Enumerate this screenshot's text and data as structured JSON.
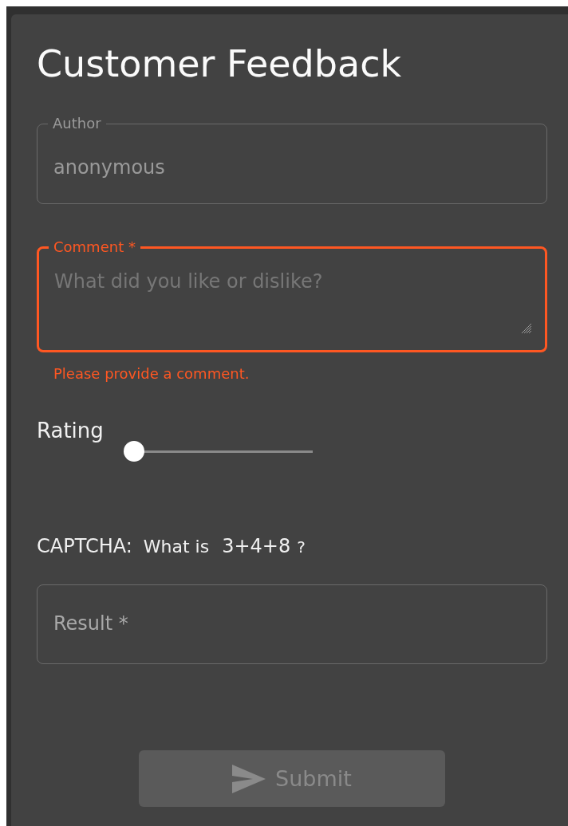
{
  "title": "Customer Feedback",
  "author": {
    "label": "Author",
    "value": "anonymous",
    "disabled": true
  },
  "comment": {
    "label": "Comment *",
    "placeholder": "What did you like or dislike?",
    "error": "Please provide a comment."
  },
  "rating": {
    "label": "Rating",
    "level": 0
  },
  "captcha": {
    "label": "CAPTCHA:",
    "prefix": "What is",
    "expression": "3+4+8",
    "suffix": "?"
  },
  "result": {
    "placeholder": "Result *"
  },
  "submit": {
    "label": "Submit",
    "disabled": true
  }
}
